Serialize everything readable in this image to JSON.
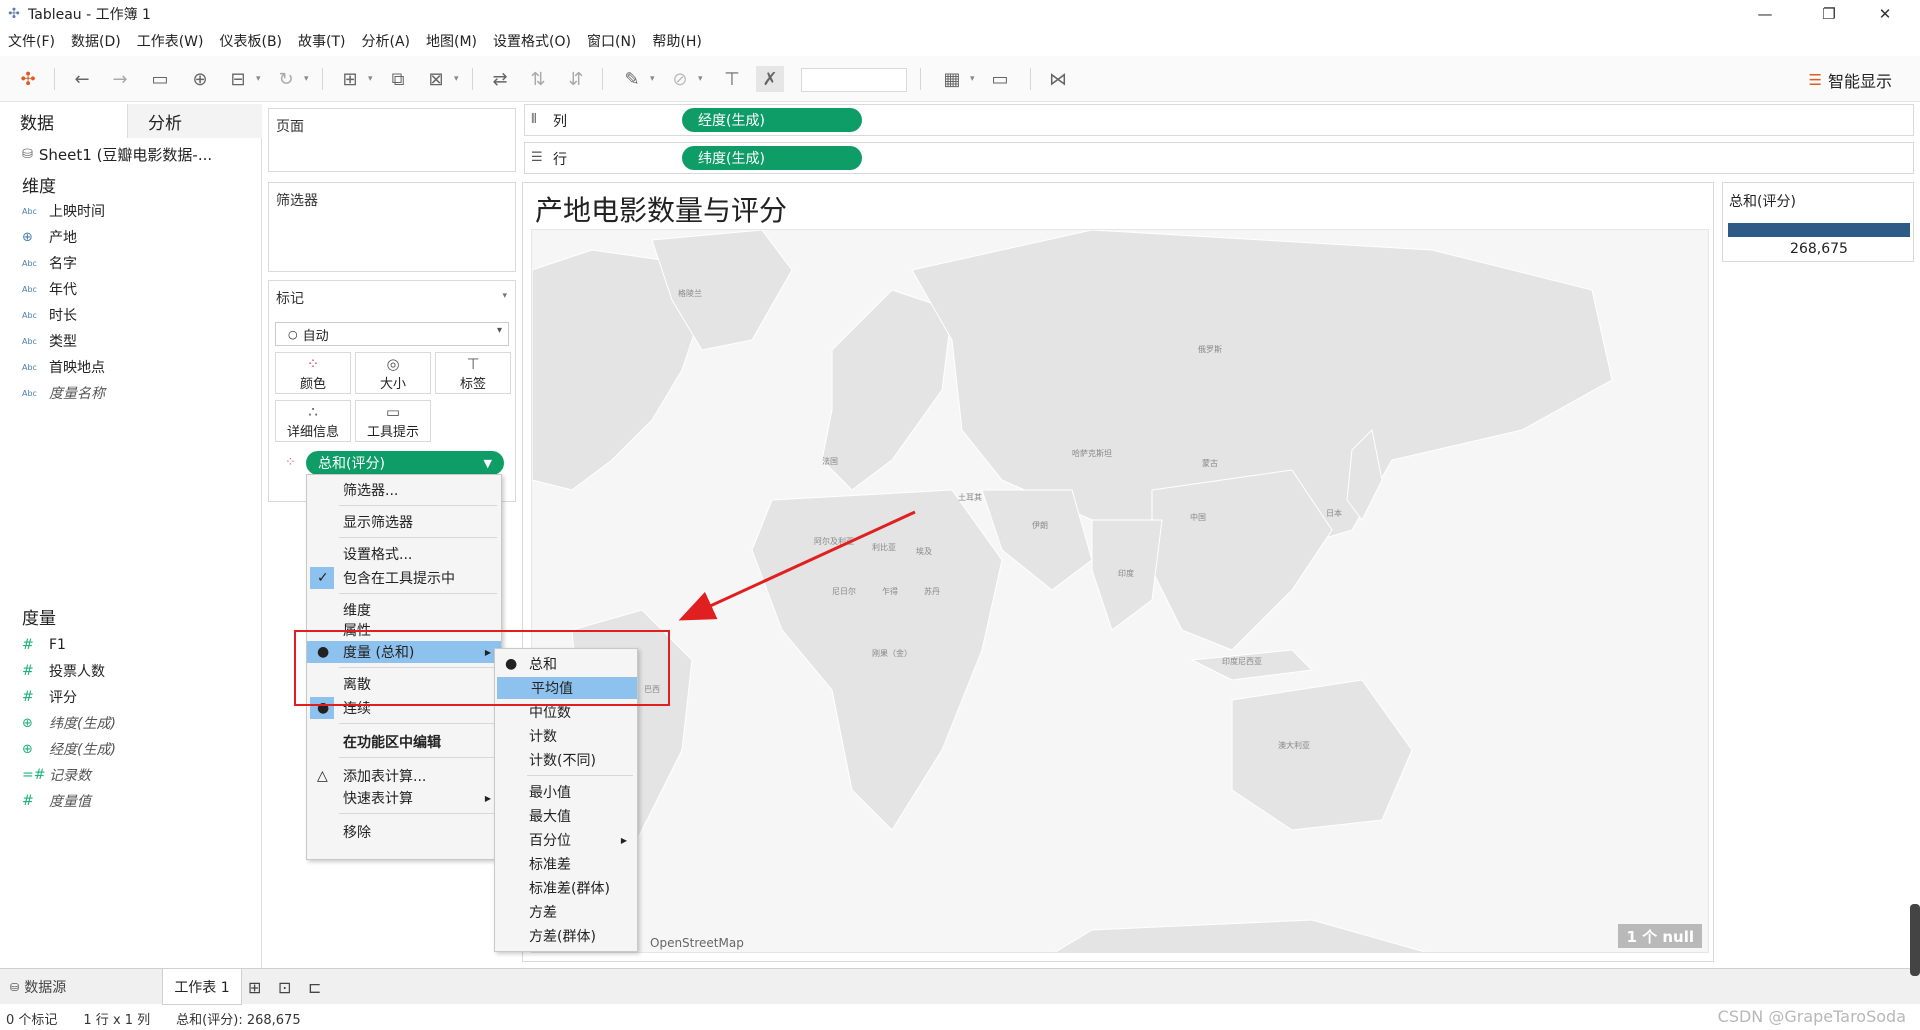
{
  "window": {
    "title": "Tableau - 工作簿 1",
    "min": "—",
    "max": "❐",
    "close": "✕"
  },
  "menu": [
    "文件(F)",
    "数据(D)",
    "工作表(W)",
    "仪表板(B)",
    "故事(T)",
    "分析(A)",
    "地图(M)",
    "设置格式(O)",
    "窗口(N)",
    "帮助(H)"
  ],
  "toolbar": {
    "show_me": "智能显示"
  },
  "left_pane": {
    "tab_data": "数据",
    "tab_analysis": "分析",
    "datasource": "Sheet1 (豆瓣电影数据-...",
    "dimensions_title": "维度",
    "dimensions": [
      {
        "icon": "Abc",
        "label": "上映时间"
      },
      {
        "icon": "globe",
        "label": "产地"
      },
      {
        "icon": "Abc",
        "label": "名字"
      },
      {
        "icon": "Abc",
        "label": "年代"
      },
      {
        "icon": "Abc",
        "label": "时长"
      },
      {
        "icon": "Abc",
        "label": "类型"
      },
      {
        "icon": "Abc",
        "label": "首映地点"
      },
      {
        "icon": "Abc",
        "label": "度量名称"
      }
    ],
    "measures_title": "度量",
    "measures": [
      {
        "icon": "#",
        "label": "F1"
      },
      {
        "icon": "#",
        "label": "投票人数"
      },
      {
        "icon": "#",
        "label": "评分"
      },
      {
        "icon": "globe",
        "label": "纬度(生成)"
      },
      {
        "icon": "globe",
        "label": "经度(生成)"
      },
      {
        "icon": "=#",
        "label": "记录数"
      },
      {
        "icon": "#",
        "label": "度量值"
      }
    ]
  },
  "shelves": {
    "pages": "页面",
    "filters": "筛选器",
    "marks": "标记",
    "marks_type": "自动",
    "mark_buttons": [
      "颜色",
      "大小",
      "标签",
      "详细信息",
      "工具提示"
    ],
    "marks_pill": "总和(评分)",
    "columns_label": "列",
    "rows_label": "行",
    "columns_pill": "经度(生成)",
    "rows_pill": "纬度(生成)"
  },
  "view": {
    "title": "产地电影数量与评分",
    "attribution": "OpenStreetMap",
    "null_badge": "1 个 null",
    "map_labels": [
      "格陵兰",
      "俄罗斯",
      "哈萨克斯坦",
      "蒙古",
      "中国",
      "日本",
      "伊朗",
      "印度",
      "阿尔及利亚",
      "利比亚",
      "埃及",
      "乍得",
      "苏丹",
      "尼日尔",
      "刚果（金）",
      "巴西",
      "澳大利亚",
      "印度尼西亚",
      "土耳其",
      "法国"
    ]
  },
  "legend": {
    "title": "总和(评分)",
    "value": "268,675"
  },
  "context_menu": {
    "items": [
      "筛选器...",
      "显示筛选器",
      "设置格式...",
      "包含在工具提示中",
      "维度",
      "属性",
      "度量 (总和)",
      "离散",
      "连续",
      "在功能区中编辑",
      "添加表计算...",
      "快速表计算",
      "移除"
    ]
  },
  "submenu": {
    "items": [
      "总和",
      "平均值",
      "中位数",
      "计数",
      "计数(不同)",
      "最小值",
      "最大值",
      "百分位",
      "标准差",
      "标准差(群体)",
      "方差",
      "方差(群体)"
    ]
  },
  "bottom": {
    "datasource_tab": "数据源",
    "sheet_tab": "工作表 1"
  },
  "status": {
    "marks": "0 个标记",
    "dims": "1 行 x 1 列",
    "sum": "总和(评分): 268,675"
  },
  "watermark": "CSDN @GrapeTaroSoda",
  "colors": {
    "pill_green": "#0f9d67",
    "legend_blue": "#2e5a87",
    "highlight_blue": "#8ec2ee",
    "annotation_red": "#e02020"
  }
}
